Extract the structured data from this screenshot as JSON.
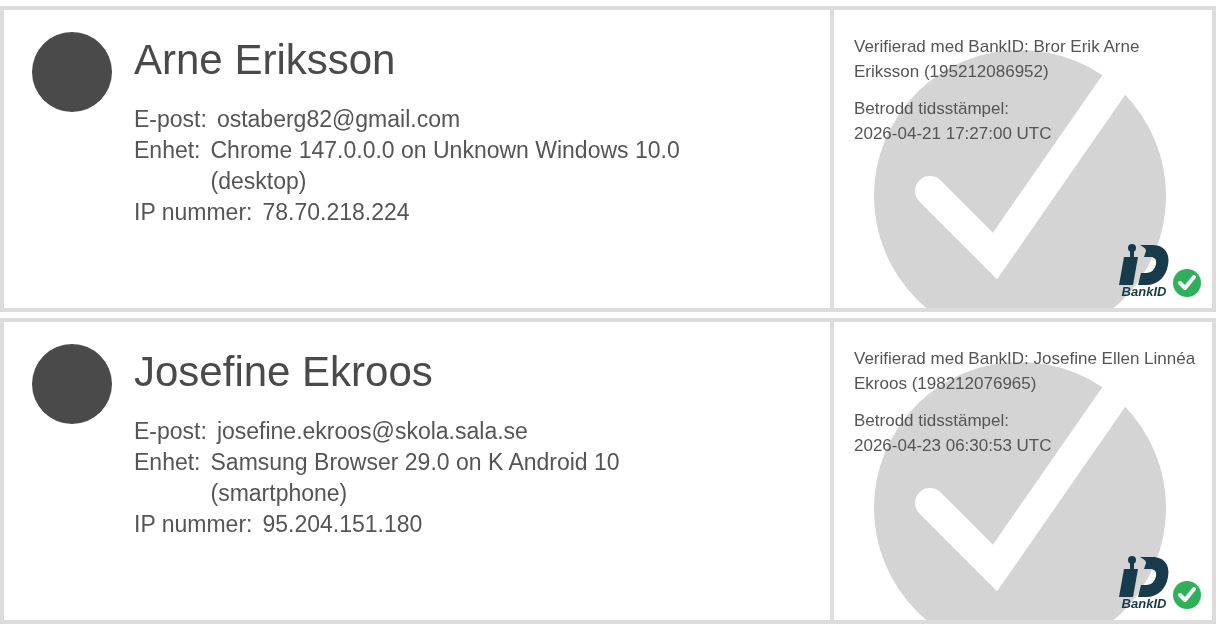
{
  "signers": [
    {
      "name": "Arne Eriksson",
      "fields": [
        {
          "label": "E-post:",
          "value": "ostaberg82@gmail.com"
        },
        {
          "label": "Enhet:",
          "value": "Chrome 147.0.0.0 on Unknown Windows 10.0 (desktop)"
        },
        {
          "label": "IP nummer:",
          "value": "78.70.218.224"
        }
      ],
      "verification": "Verifierad med BankID: Bror Erik Arne Eriksson (195212086952)",
      "timestamp_label": "Betrodd tidsstämpel:",
      "timestamp": "2026-04-21 17:27:00 UTC",
      "logo_text": "BankID"
    },
    {
      "name": "Josefine Ekroos",
      "fields": [
        {
          "label": "E-post:",
          "value": "josefine.ekroos@skola.sala.se"
        },
        {
          "label": "Enhet:",
          "value": "Samsung Browser 29.0 on K Android 10 (smartphone)"
        },
        {
          "label": "IP nummer:",
          "value": "95.204.151.180"
        }
      ],
      "verification": "Verifierad med BankID: Josefine Ellen Linnéa Ekroos (198212076965)",
      "timestamp_label": "Betrodd tidsstämpel:",
      "timestamp": "2026-04-23 06:30:53 UTC",
      "logo_text": "BankID"
    }
  ]
}
